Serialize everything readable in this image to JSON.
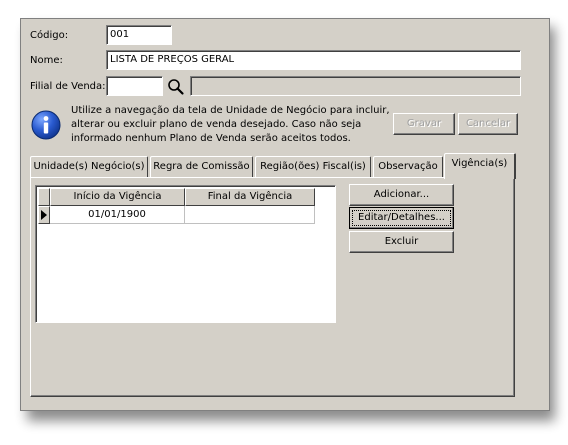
{
  "form": {
    "codigo_label": "Código:",
    "codigo_value": "001",
    "nome_label": "Nome:",
    "nome_value": "LISTA DE PREÇOS GERAL",
    "filial_label": "Filial de Venda:",
    "filial_value": "",
    "filial_desc": ""
  },
  "info": {
    "line1": "Utilize a navegação da tela de Unidade de Negócio para incluir,",
    "line2": "alterar ou excluir plano de venda desejado. Caso não seja",
    "line3": "informado nenhum Plano de Venda serão aceitos todos."
  },
  "actions": {
    "gravar": "Gravar",
    "cancelar": "Cancelar"
  },
  "tabs": [
    {
      "label": "Unidade(s) Negócio(s)"
    },
    {
      "label": "Regra de Comissão"
    },
    {
      "label": "Região(ões) Fiscal(is)"
    },
    {
      "label": "Observação"
    },
    {
      "label": "Vigência(s)"
    }
  ],
  "active_tab": "Vigência(s)",
  "grid": {
    "columns": [
      "Início da Vigência",
      "Final da Vigência"
    ],
    "rows": [
      {
        "inicio": "01/01/1900",
        "final": ""
      }
    ]
  },
  "side_buttons": {
    "adicionar": "Adicionar...",
    "editar": "Editar/Detalhes...",
    "excluir": "Excluir"
  },
  "icons": {
    "search": "magnifier-icon",
    "info": "info-icon",
    "row_pointer": "row-pointer-icon"
  },
  "colors": {
    "window_bg": "#d4d0c8",
    "info_blue": "#1e4fb0"
  }
}
